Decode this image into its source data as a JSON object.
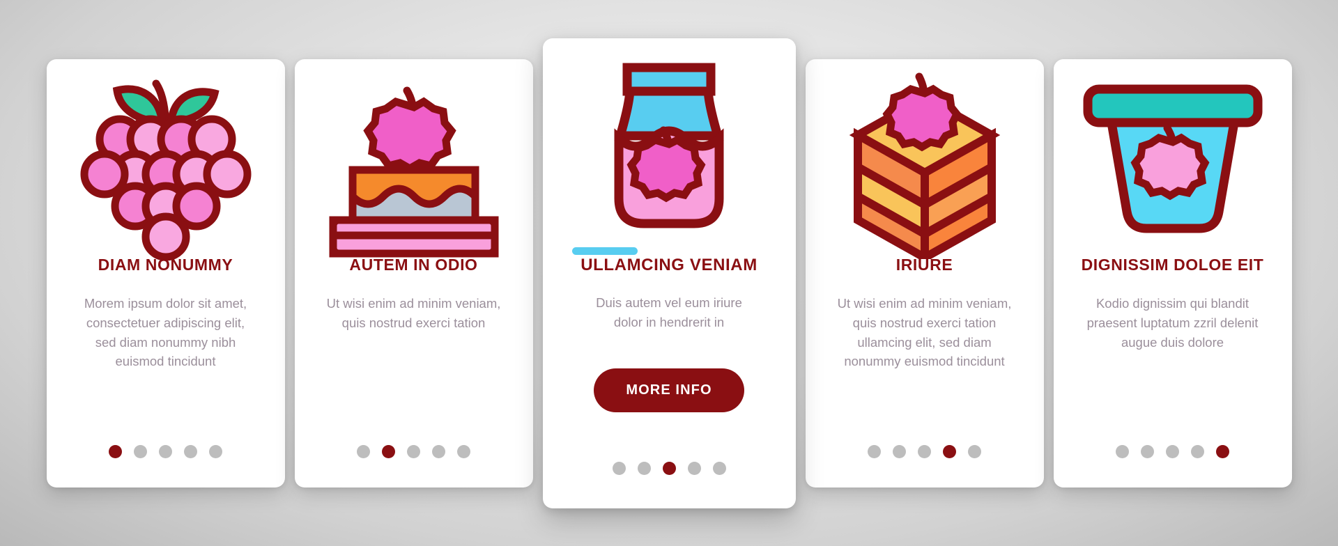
{
  "theme": {
    "accent_red": "#8a0f12",
    "accent_cyan": "#58cdf0",
    "body_text": "#9b8f9b",
    "dot_inactive": "#bdbdbd",
    "card_bg": "#ffffff"
  },
  "cards": [
    {
      "icon": "raspberry-bunch-icon",
      "title": "DIAM NONUMMY",
      "body": "Morem ipsum dolor sit amet, consectetuer adipiscing elit, sed diam nonummy nibh euismod tincidunt",
      "dots": {
        "count": 5,
        "active_index": 0
      },
      "featured": false
    },
    {
      "icon": "raspberry-cake-icon",
      "title": "AUTEM IN ODIO",
      "body": "Ut wisi enim ad minim veniam, quis nostrud exerci tation",
      "dots": {
        "count": 5,
        "active_index": 1
      },
      "featured": false
    },
    {
      "icon": "raspberry-jam-jar-icon",
      "title": "ULLAMCING VENIAM",
      "body": "Duis autem vel eum iriure dolor in hendrerit in",
      "button_label": "MORE INFO",
      "dots": {
        "count": 5,
        "active_index": 2
      },
      "featured": true
    },
    {
      "icon": "raspberry-cake-slice-icon",
      "title": "IRIURE",
      "body": "Ut wisi enim ad minim veniam, quis nostrud exerci tation ullamcing elit, sed diam nonummy euismod tincidunt",
      "dots": {
        "count": 5,
        "active_index": 3
      },
      "featured": false
    },
    {
      "icon": "raspberry-yogurt-cup-icon",
      "title": "DIGNISSIM DOLOE EIT",
      "body": "Kodio dignissim qui blandit praesent luptatum zzril delenit augue duis dolore",
      "dots": {
        "count": 5,
        "active_index": 4
      },
      "featured": false
    }
  ]
}
